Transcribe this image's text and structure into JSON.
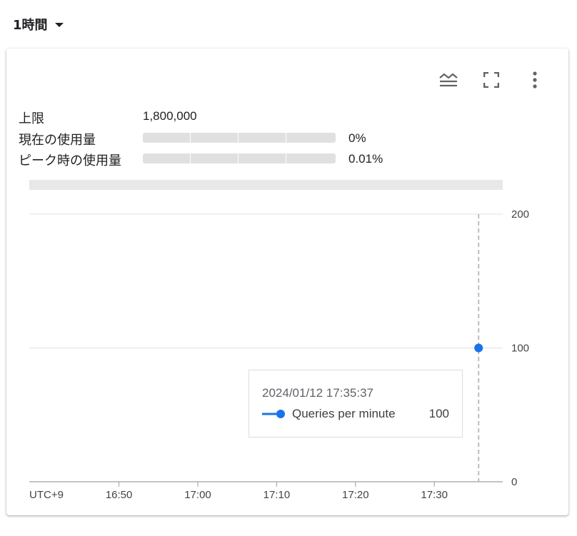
{
  "time_range": {
    "label": "1時間"
  },
  "quota": {
    "limit_label": "上限",
    "limit_value": "1,800,000",
    "current_label": "現在の使用量",
    "current_value": "0%",
    "current_fraction": 0.0,
    "peak_label": "ピーク時の使用量",
    "peak_value": "0.01%",
    "peak_fraction": 0.0001
  },
  "toolbar": {
    "legend_icon": "stacked-lines-icon",
    "fullscreen_icon": "fullscreen-icon",
    "more_icon": "more-vert-icon"
  },
  "colors": {
    "series": "#1a73e8",
    "cursor": "#bdbdbd"
  },
  "chart_data": {
    "type": "line",
    "x_ticks": [
      "UTC+9",
      "16:50",
      "17:00",
      "17:10",
      "17:20",
      "17:30"
    ],
    "y_ticks": [
      "200",
      "100",
      "0"
    ],
    "ylim": [
      0,
      200
    ],
    "series": [
      {
        "name": "Queries per minute",
        "points": [
          {
            "x": "17:35:37",
            "y": 100
          }
        ]
      }
    ],
    "tooltip": {
      "time": "2024/01/12 17:35:37",
      "series": "Queries per minute",
      "value": "100"
    }
  }
}
